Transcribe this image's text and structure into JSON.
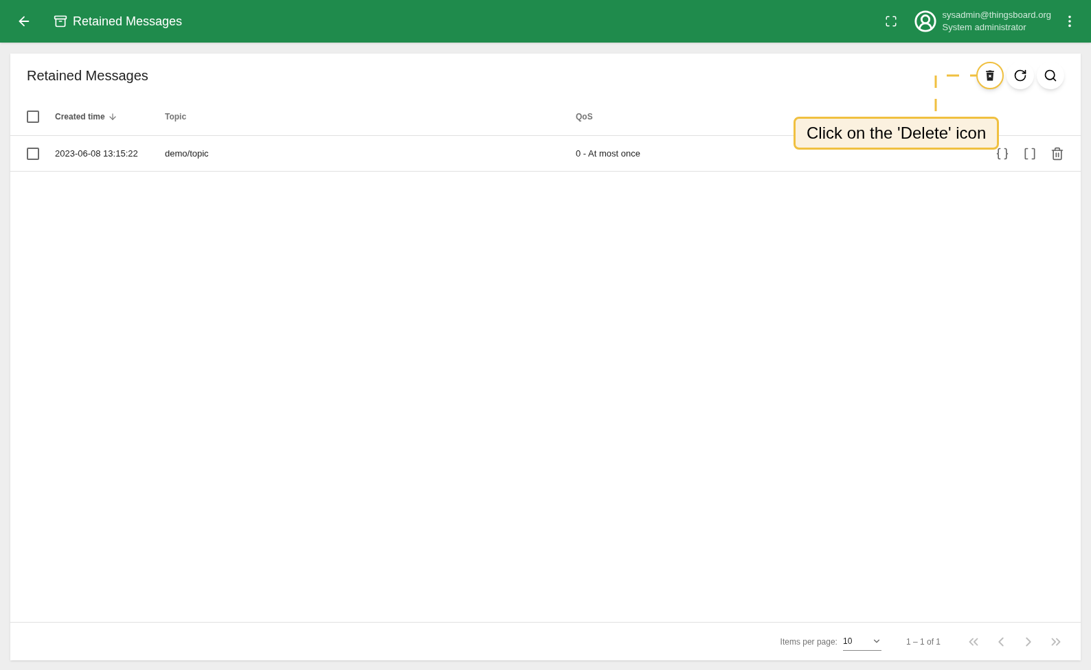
{
  "toolbar": {
    "title": "Retained Messages",
    "user": {
      "email": "sysadmin@thingsboard.org",
      "role": "System administrator"
    }
  },
  "card": {
    "title": "Retained Messages"
  },
  "table": {
    "columns": [
      {
        "label": "Created time",
        "sorted": true
      },
      {
        "label": "Topic",
        "sorted": false
      },
      {
        "label": "QoS",
        "sorted": false
      }
    ],
    "select_all": {
      "checked": false
    },
    "rows": [
      {
        "checked": false,
        "cells": [
          "2023-06-08 13:15:22",
          "demo/topic",
          "0 - At most once"
        ]
      }
    ]
  },
  "callout": {
    "text": "Click on the 'Delete' icon"
  },
  "paginator": {
    "items_label": "Items per page:",
    "page_size": "10",
    "range": "1 – 1 of 1",
    "buttons": [
      {
        "kind": "first",
        "disabled": true
      },
      {
        "kind": "prev",
        "disabled": true
      },
      {
        "kind": "next",
        "disabled": true
      },
      {
        "kind": "last",
        "disabled": true
      }
    ]
  }
}
